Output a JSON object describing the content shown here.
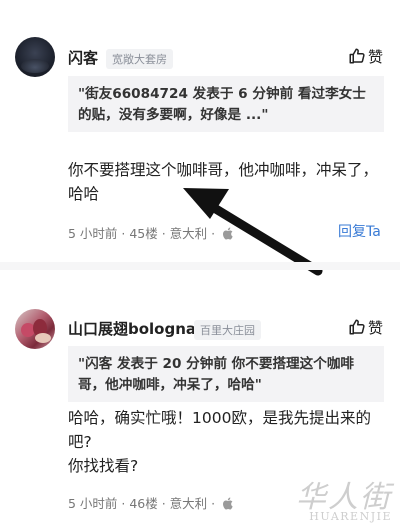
{
  "comments": [
    {
      "username": "闪客",
      "tag": "宽敞大套房",
      "like_label": "赞",
      "quote": "\"街友66084724 发表于 6 分钟前 看过李女士的贴，没有多要啊，好像是 ...\"",
      "content_lines": [
        "你不要搭理这个咖啡哥，他冲咖啡，冲呆了，",
        "哈哈"
      ],
      "meta": "5 小时前 · 45楼 · 意大利 · ",
      "reply_label": "回复Ta"
    },
    {
      "username": "山口展翅bologna",
      "tag": "百里大庄园",
      "like_label": "赞",
      "quote": "\"闪客 发表于 20 分钟前 你不要搭理这个咖啡哥，他冲咖啡，冲呆了，哈哈\"",
      "content_lines": [
        "哈哈，确实忙哦！1000欧，是我先提出来的",
        "吧?",
        "你找找看?"
      ],
      "meta": "5 小时前 · 46楼 · 意大利 · "
    }
  ],
  "watermark": {
    "cn": "华人街",
    "en": "HUARENJIE"
  },
  "icons": {
    "like": "thumbs-up-icon",
    "device": "apple-icon",
    "arrow": "annotation-arrow"
  },
  "colors": {
    "link": "#3a7bd5",
    "quote_bg": "#f3f3f5"
  }
}
